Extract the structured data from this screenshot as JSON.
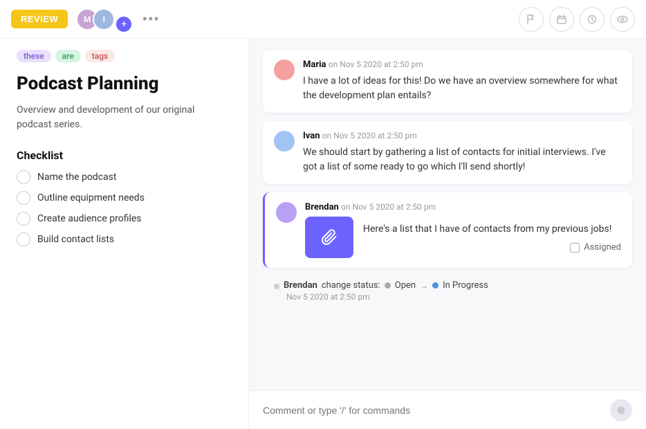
{
  "topbar": {
    "review_label": "REVIEW",
    "dots_label": "•••",
    "avatar1_initials": "M",
    "avatar2_initials": "I",
    "add_icon": "+",
    "icons": [
      "⚑",
      "▭",
      "⏱",
      "◉"
    ]
  },
  "left": {
    "tags": [
      {
        "id": "these",
        "label": "these",
        "class": "tag-these"
      },
      {
        "id": "are",
        "label": "are",
        "class": "tag-are"
      },
      {
        "id": "tags",
        "label": "tags",
        "class": "tag-tags"
      }
    ],
    "title": "Podcast Planning",
    "description": "Overview and development of our original podcast series.",
    "checklist_heading": "Checklist",
    "checklist_items": [
      "Name the podcast",
      "Outline equipment needs",
      "Create audience profiles",
      "Build contact lists"
    ]
  },
  "right": {
    "comments": [
      {
        "id": "maria",
        "author": "Maria",
        "meta": "on Nov 5 2020 at 2:50 pm",
        "text": "I have a lot of ideas for this! Do we have an overview somewhere for what the development plan entails?",
        "avatar_class": "ca-maria",
        "highlighted": false
      },
      {
        "id": "ivan",
        "author": "Ivan",
        "meta": "on Nov 5 2020 at 2:50 pm",
        "text": "We should start by gathering a list of contacts for initial interviews. I've got a list of some ready to go which I'll send shortly!",
        "avatar_class": "ca-ivan",
        "highlighted": false
      }
    ],
    "brendan_comment": {
      "author": "Brendan",
      "meta": "on Nov 5 2020 at 2:50 pm",
      "text": "Here's a list that I have of contacts from my previous jobs!",
      "avatar_class": "ca-brendan",
      "assigned_label": "Assigned"
    },
    "status_change": {
      "author": "Brendan",
      "action": "change status:",
      "from": "Open",
      "arrow": "→",
      "to": "In Progress",
      "time": "Nov 5 2020 at 2:50 pm"
    },
    "input_placeholder": "Comment or type '/' for commands"
  }
}
